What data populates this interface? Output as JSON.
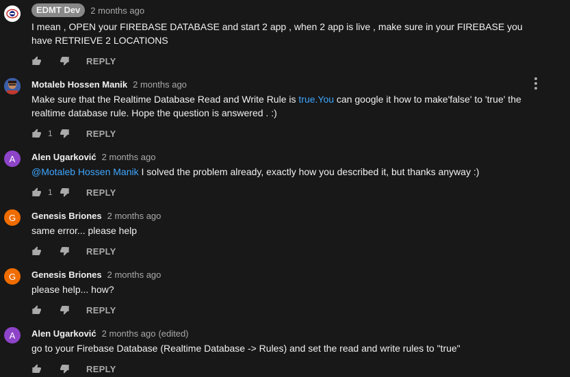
{
  "comments": [
    {
      "author": "EDMT Dev",
      "time": "2 months ago",
      "text": "I mean , OPEN your FIREBASE DATABASE and start 2 app , when 2 app is live , make sure in your FIREBASE you have RETRIEVE 2 LOCATIONS",
      "likes": "",
      "reply": "REPLY",
      "avatar_color": "#ffffff"
    },
    {
      "author": "Motaleb Hossen Manik",
      "time": "2 months ago",
      "text_before": "Make sure that the Realtime Database Read and Write Rule is ",
      "text_link": "true.You",
      "text_after": " can google it how to make'false' to 'true' the realtime database rule. Hope the question is answered . :)",
      "likes": "1",
      "reply": "REPLY",
      "avatar_color": "#3b5ea8"
    },
    {
      "author": "Alen Ugarković",
      "time": "2 months ago",
      "mention": "@Motaleb Hossen Manik",
      "text": " I solved the problem already, exactly how you described it, but thanks anyway :)",
      "likes": "1",
      "reply": "REPLY",
      "avatar_letter": "A",
      "avatar_color": "#8e44c9"
    },
    {
      "author": "Genesis Briones",
      "time": "2 months ago",
      "text": "same error... please help",
      "likes": "",
      "reply": "REPLY",
      "avatar_letter": "G",
      "avatar_color": "#ef6c00"
    },
    {
      "author": "Genesis Briones",
      "time": "2 months ago",
      "text": "please help... how?",
      "likes": "",
      "reply": "REPLY",
      "avatar_letter": "G",
      "avatar_color": "#ef6c00"
    },
    {
      "author": "Alen Ugarković",
      "time": "2 months ago",
      "edited": "(edited)",
      "text": "go to your Firebase Database (Realtime Database -> Rules) and set the read and write rules to \"true\"",
      "likes": "",
      "reply": "REPLY",
      "avatar_letter": "A",
      "avatar_color": "#8e44c9"
    }
  ],
  "icons": {
    "like": "thumbs-up-icon",
    "dislike": "thumbs-down-icon",
    "more": "more-vertical-icon",
    "icon_color": "#aaaaaa"
  }
}
